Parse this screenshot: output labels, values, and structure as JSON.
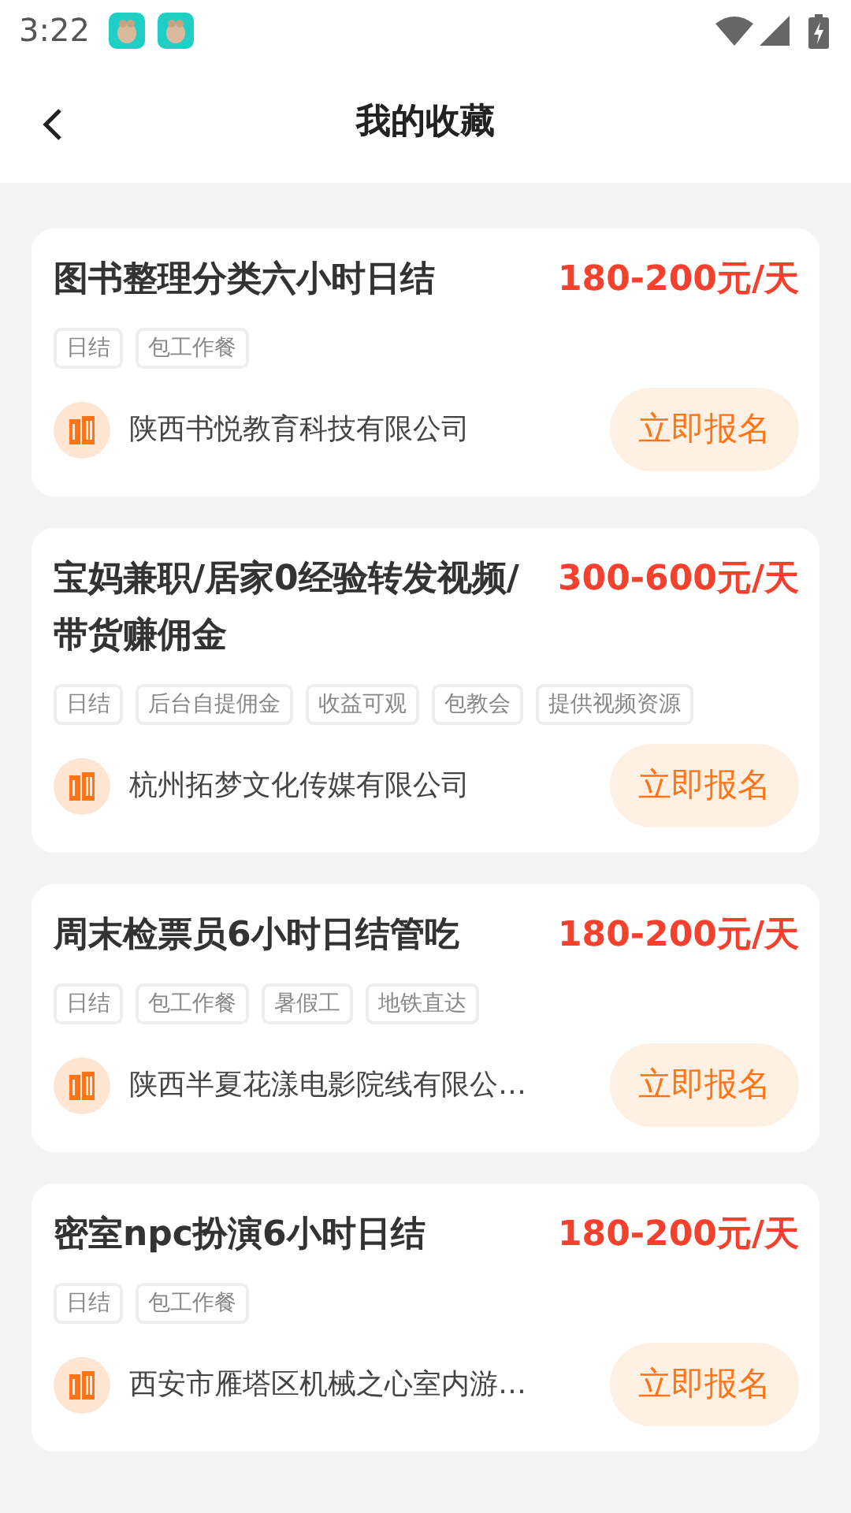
{
  "status_bar": {
    "time": "3:22",
    "notifications": [
      {
        "kind": "app"
      },
      {
        "kind": "app"
      }
    ]
  },
  "header": {
    "title": "我的收藏"
  },
  "jobs": [
    {
      "title": "图书整理分类六小时日结",
      "salary": "180-200元/天",
      "tags": [
        "日结",
        "包工作餐"
      ],
      "company": "陕西书悦教育科技有限公司",
      "action": "立即报名"
    },
    {
      "title": "宝妈兼职/居家0经验转发视频/带货赚佣金",
      "salary": "300-600元/天",
      "tags": [
        "日结",
        "后台自提佣金",
        "收益可观",
        "包教会",
        "提供视频资源"
      ],
      "company": "杭州拓梦文化传媒有限公司",
      "action": "立即报名"
    },
    {
      "title": "周末检票员6小时日结管吃",
      "salary": "180-200元/天",
      "tags": [
        "日结",
        "包工作餐",
        "暑假工",
        "地铁直达"
      ],
      "company": "陕西半夏花漾电影院线有限公…",
      "action": "立即报名"
    },
    {
      "title": "密室npc扮演6小时日结",
      "salary": "180-200元/天",
      "tags": [
        "日结",
        "包工作餐"
      ],
      "company": "西安市雁塔区机械之心室内游…",
      "action": "立即报名"
    }
  ]
}
